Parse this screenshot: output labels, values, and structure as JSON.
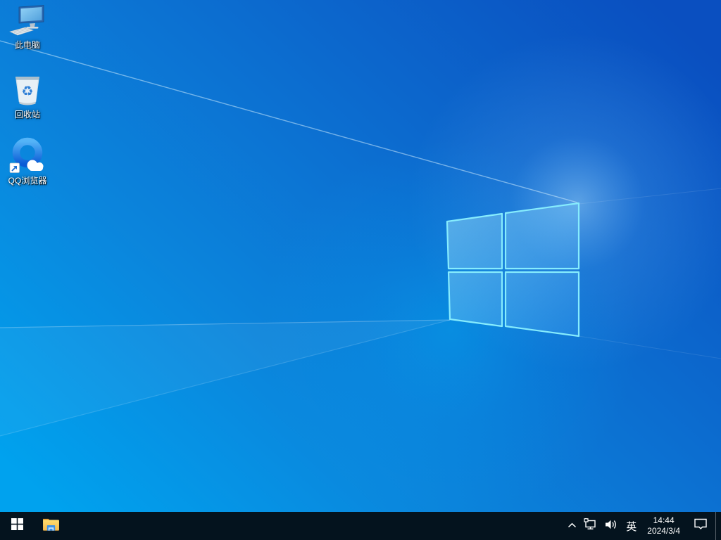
{
  "desktop": {
    "wallpaper_name": "windows-10-default-light-blue",
    "icons": [
      {
        "id": "this-pc",
        "label": "此电脑",
        "icon": "this-pc-icon"
      },
      {
        "id": "recycle-bin",
        "label": "回收站",
        "icon": "recycle-bin-icon"
      },
      {
        "id": "qq-browser",
        "label": "QQ浏览器",
        "icon": "qq-browser-icon",
        "shortcut_overlay": true
      }
    ]
  },
  "taskbar": {
    "buttons": [
      {
        "id": "start",
        "icon": "windows-start-icon"
      },
      {
        "id": "file-explorer",
        "icon": "file-explorer-icon"
      }
    ],
    "tray": {
      "hidden_icons": {
        "icon": "chevron-up-icon"
      },
      "network": {
        "icon": "ethernet-network-icon"
      },
      "volume": {
        "icon": "speaker-icon"
      },
      "ime_label": "英",
      "clock": {
        "time": "14:44",
        "date": "2024/3/4"
      },
      "action_center": {
        "icon": "action-center-icon"
      },
      "show_desktop": {
        "icon": "show-desktop-strip"
      }
    }
  },
  "colors": {
    "taskbar_bg": "#04131e",
    "wallpaper_bottom_left": "#00a2ee",
    "wallpaper_top_right": "#0a4fc0",
    "logo_edge_cyan": "#86ecfd",
    "icon_text": "#ffffff"
  }
}
